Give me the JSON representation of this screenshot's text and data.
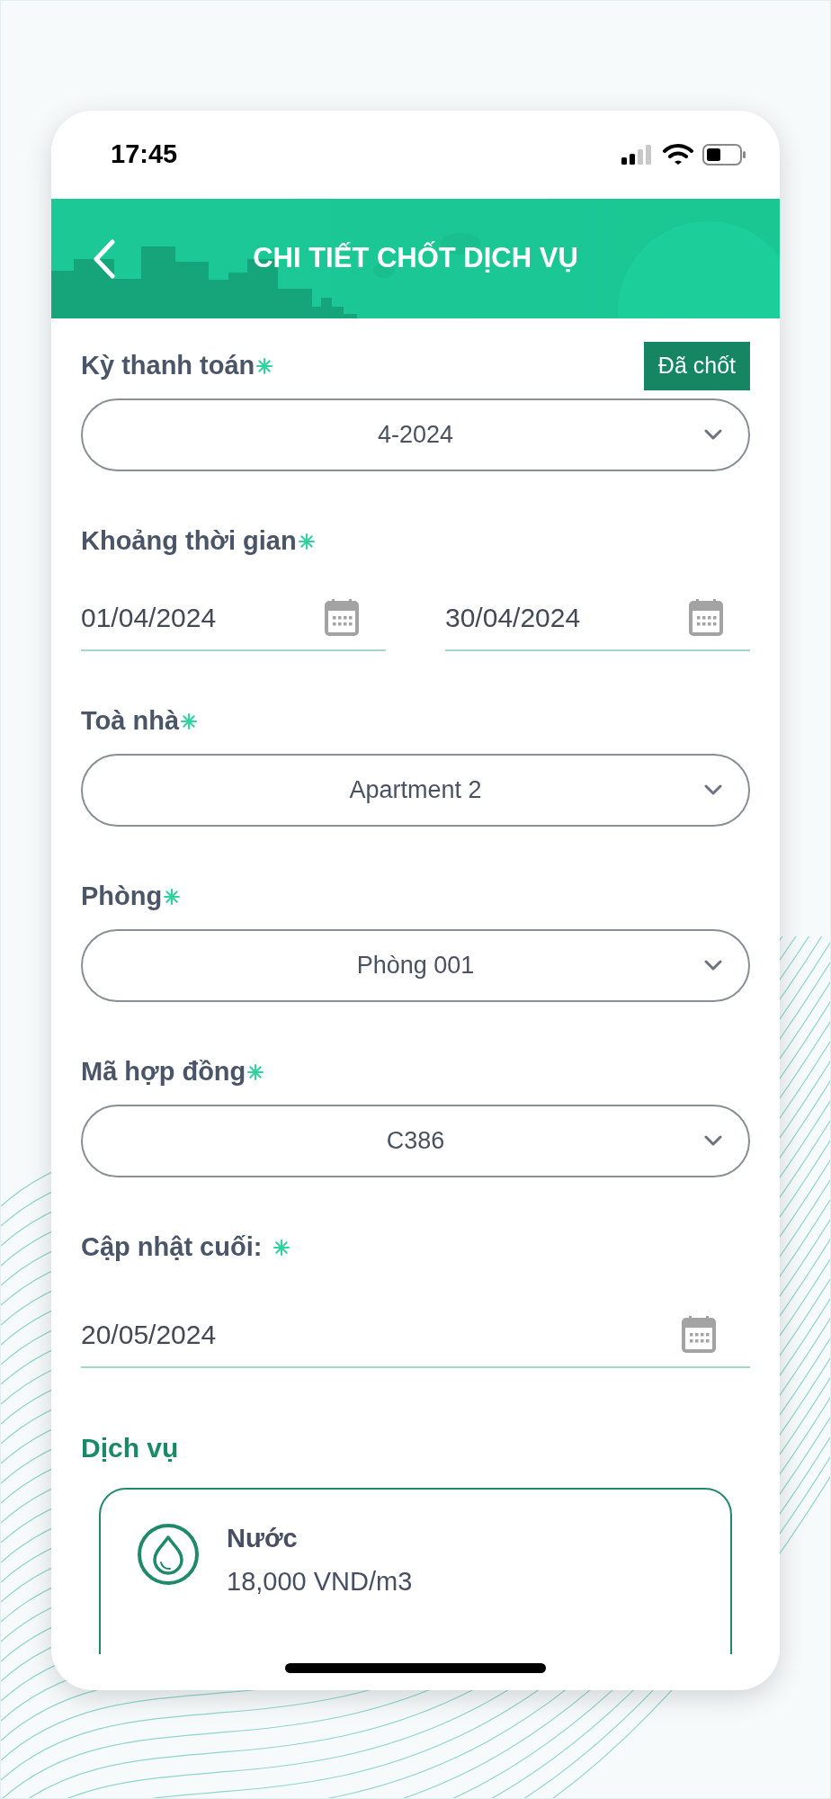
{
  "status_bar": {
    "time": "17:45"
  },
  "header": {
    "title": "CHI TIẾT CHỐT DỊCH VỤ"
  },
  "fields": [
    {
      "kind": "select",
      "label": "Kỳ thanh toán",
      "required": true,
      "badge": "Đã chốt",
      "value": "4-2024"
    },
    {
      "kind": "date_range",
      "label": "Khoảng thời gian",
      "required": true,
      "values": [
        "01/04/2024",
        "30/04/2024"
      ]
    },
    {
      "kind": "select",
      "label": "Toà nhà",
      "required": true,
      "value": "Apartment 2"
    },
    {
      "kind": "select",
      "label": "Phòng",
      "required": true,
      "value": "Phòng 001"
    },
    {
      "kind": "select",
      "label": "Mã hợp đồng",
      "required": true,
      "value": "C386"
    },
    {
      "kind": "date",
      "label": "Cập nhật cuối:",
      "required": true,
      "value": "20/05/2024"
    }
  ],
  "services": {
    "title": "Dịch vụ",
    "items": [
      {
        "name": "Nước",
        "price": "18,000 VND/m3"
      }
    ]
  }
}
